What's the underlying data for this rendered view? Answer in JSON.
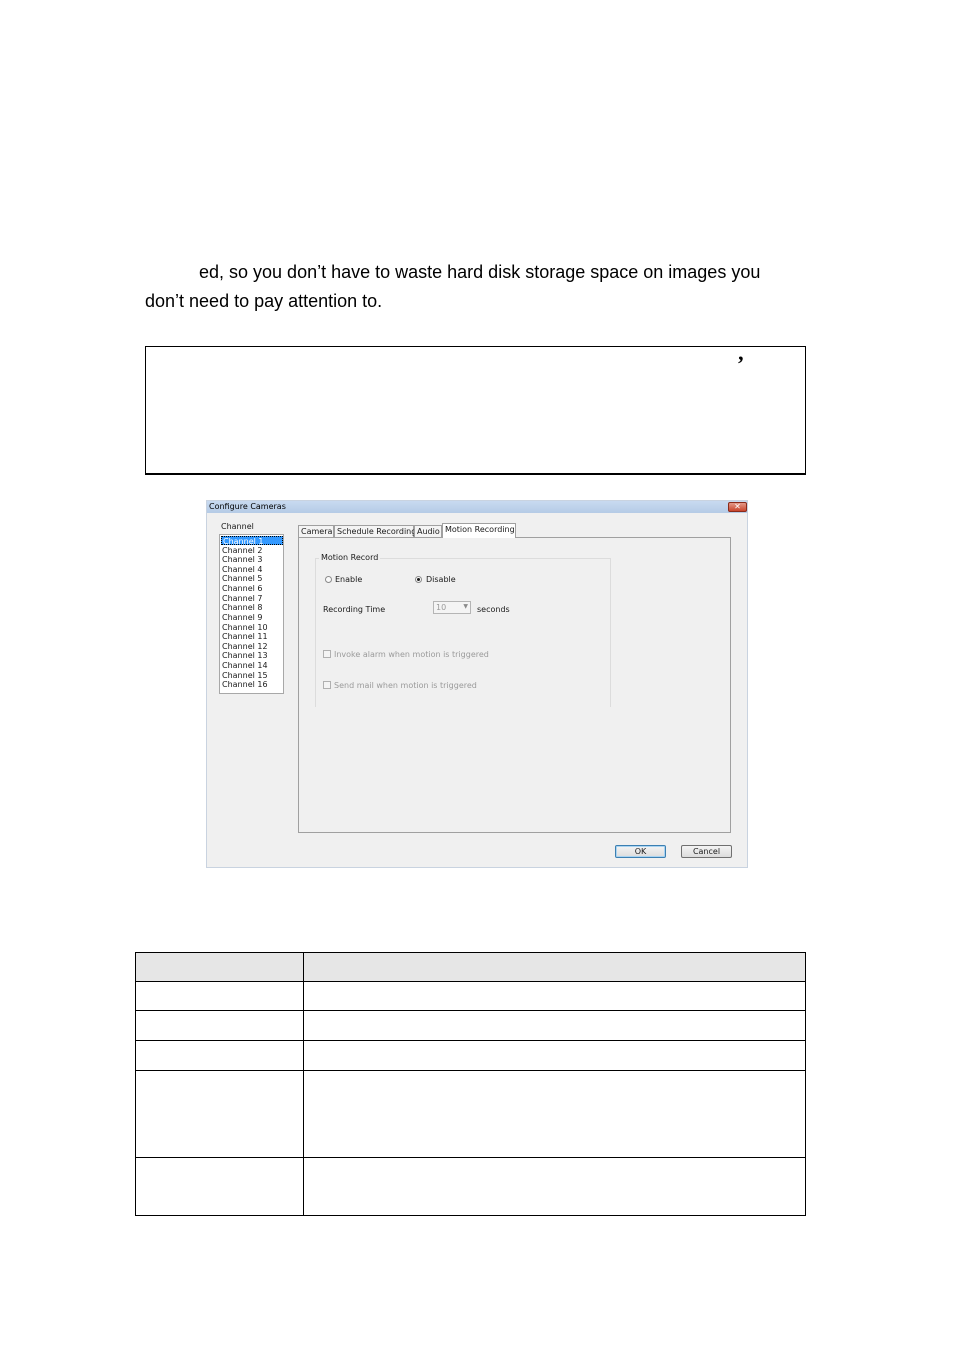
{
  "document": {
    "paragraph_line1": "ed, so you don’t have to waste hard disk storage space on images you",
    "paragraph_line2": "don’t need to pay attention to.",
    "note_mark": "’"
  },
  "dialog": {
    "title": "Configure Cameras",
    "close_glyph": "✕",
    "channel_label": "Channel",
    "channels": [
      "Channel 1",
      "Channel 2",
      "Channel 3",
      "Channel 4",
      "Channel 5",
      "Channel 6",
      "Channel 7",
      "Channel 8",
      "Channel 9",
      "Channel 10",
      "Channel 11",
      "Channel 12",
      "Channel 13",
      "Channel 14",
      "Channel 15",
      "Channel 16"
    ],
    "selected_channel": "Channel 1",
    "tabs": [
      "Camera",
      "Schedule Recording",
      "Audio",
      "Motion Recording"
    ],
    "active_tab": "Motion Recording",
    "motion_record": {
      "group_label": "Motion Record",
      "enable_label": "Enable",
      "disable_label": "Disable",
      "selected": "Disable",
      "recording_time_label": "Recording Time",
      "recording_time_value": "10",
      "seconds_label": "seconds",
      "invoke_alarm_label": "Invoke alarm when motion is triggered",
      "send_mail_label": "Send mail when motion is triggered"
    },
    "ok_label": "OK",
    "cancel_label": "Cancel"
  },
  "table": {
    "rows": [
      [
        "",
        ""
      ],
      [
        "",
        ""
      ],
      [
        "",
        ""
      ],
      [
        "",
        ""
      ],
      [
        "",
        ""
      ],
      [
        "",
        ""
      ]
    ]
  }
}
